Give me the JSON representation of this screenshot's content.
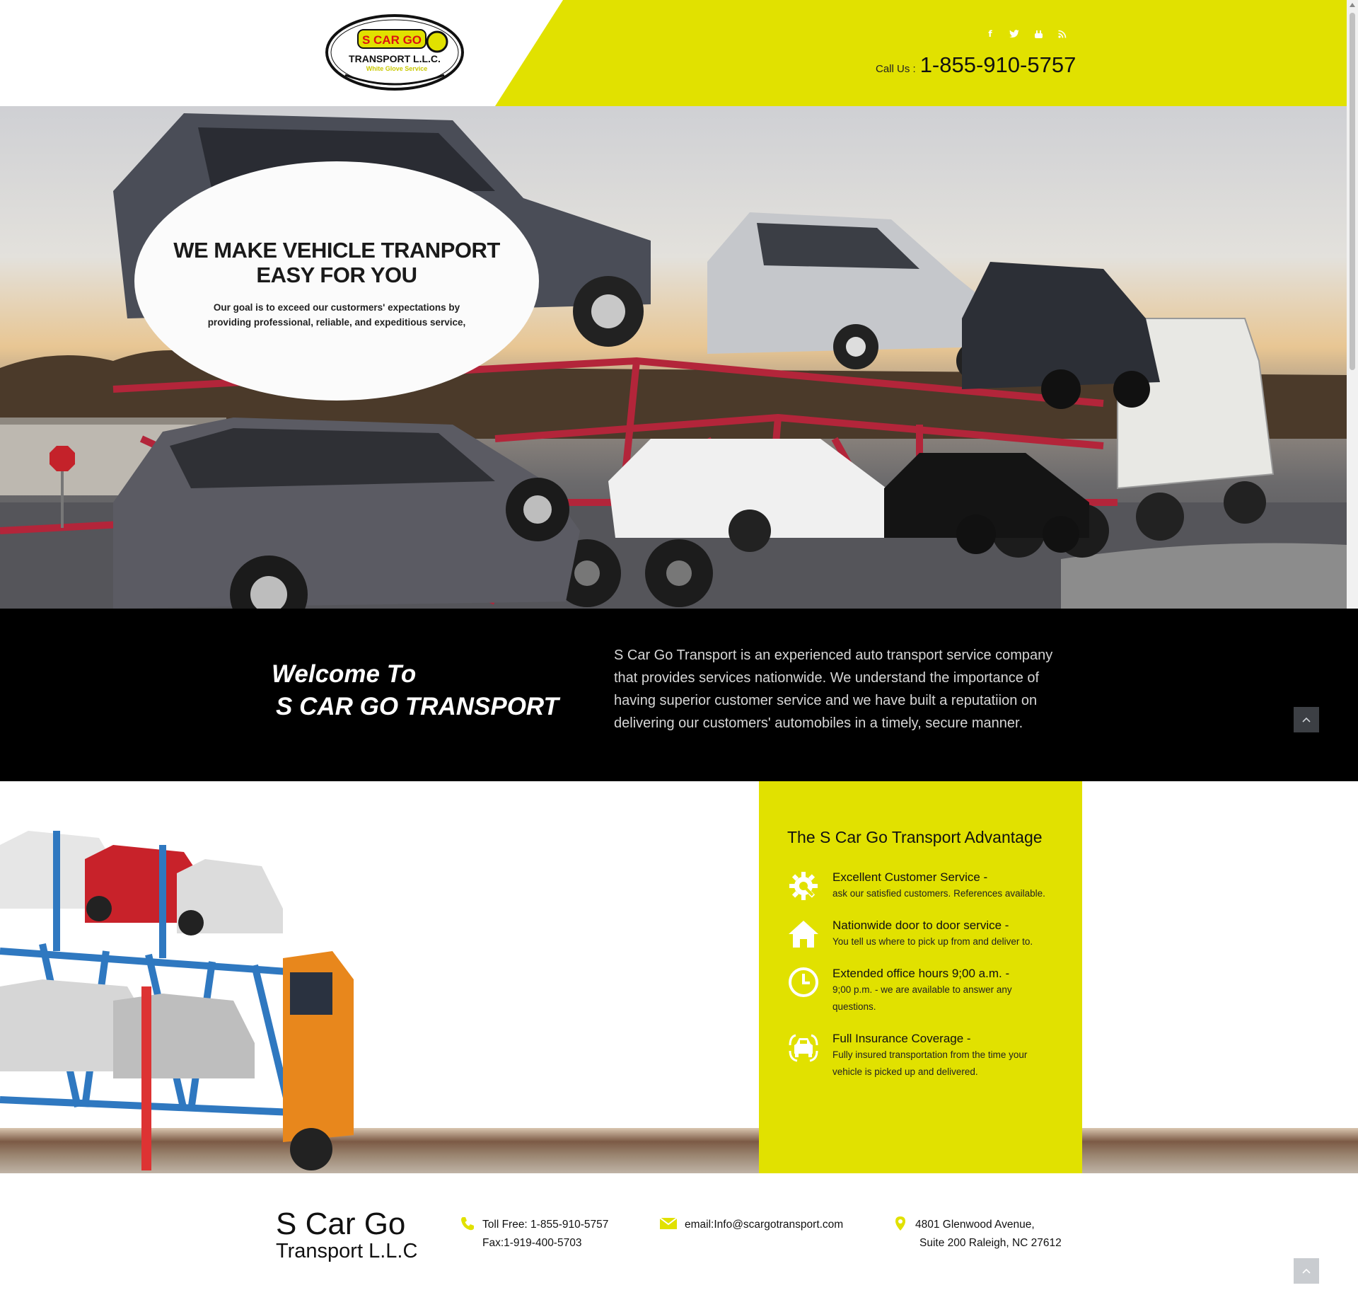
{
  "header": {
    "logo": {
      "line1": "S CAR GO",
      "line2": "TRANSPORT L.L.C.",
      "tagline": "White Glove Service"
    },
    "social": [
      "facebook-icon",
      "twitter-icon",
      "youtube-icon",
      "rss-icon"
    ],
    "call_label": "Call Us :",
    "call_number": "1-855-910-5757",
    "accent_color": "#e1e100"
  },
  "hero": {
    "title_line1": "WE MAKE VEHICLE TRANPORT",
    "title_line2": "EASY FOR YOU",
    "subtitle": "Our goal is to exceed our custormers' expectations by providing professional, reliable, and expeditious service,"
  },
  "welcome": {
    "title_line1": "Welcome To",
    "title_line2": "S CAR GO TRANSPORT",
    "text": "S Car Go Transport is an experienced auto transport service company that provides services nationwide. We understand the importance of having superior customer service and we have built a reputatiion on delivering our customers' automobiles in a timely, secure manner."
  },
  "advantage": {
    "heading": "The S Car Go Transport Advantage",
    "items": [
      {
        "icon": "gear-icon",
        "title": "Excellent Customer Service -",
        "desc": "ask our satisfied customers. References available."
      },
      {
        "icon": "home-icon",
        "title": "Nationwide door to door service -",
        "desc": "You tell us where to pick up from and deliver to."
      },
      {
        "icon": "clock-icon",
        "title": "Extended office hours 9;00 a.m. -",
        "desc": "9;00 p.m. - we are available to answer any questions."
      },
      {
        "icon": "car-insurance-icon",
        "title": "Full Insurance Coverage -",
        "desc": "Fully insured transportation from the time your vehicle is picked up and delivered."
      }
    ]
  },
  "footer": {
    "brand_line1": "S Car Go",
    "brand_line2": "Transport L.L.C",
    "toll_free": "Toll Free: 1-855-910-5757",
    "fax": "Fax:1-919-400-5703",
    "email": "email:Info@scargotransport.com",
    "address_line1": "4801 Glenwood Avenue,",
    "address_line2": "Suite 200 Raleigh, NC 27612"
  }
}
